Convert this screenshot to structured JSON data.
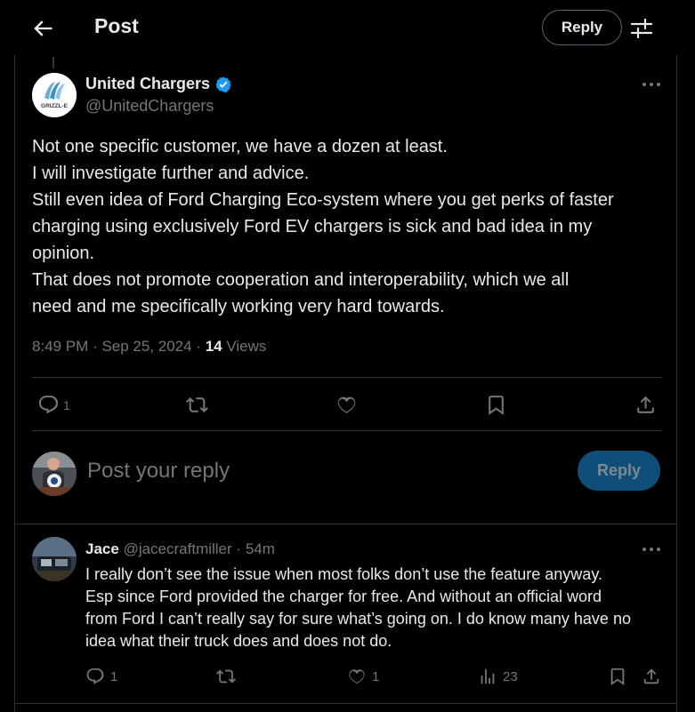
{
  "header": {
    "title": "Post",
    "reply_label": "Reply"
  },
  "post": {
    "author_name": "United Chargers",
    "author_handle": "@UnitedChargers",
    "avatar_text": "GRIZZL-E",
    "lines": [
      "Not one specific customer, we have a dozen at least.",
      "I will investigate further and advice.",
      "Still even idea of Ford Charging Eco-system where you get perks of faster",
      "charging using exclusively Ford EV chargers is sick and bad idea in my",
      "opinion.",
      "That does not promote cooperation and interoperability, which we all",
      "need and me specifically working very hard towards."
    ],
    "time": "8:49 PM",
    "date": "Sep 25, 2024",
    "views_count": "14",
    "views_label": "Views",
    "reply_count": "1"
  },
  "compose": {
    "placeholder": "Post your reply",
    "button": "Reply"
  },
  "reply": {
    "name": "Jace",
    "handle": "@jacecraftmiller",
    "age": "54m",
    "lines": [
      "I really don’t see the issue when most folks don’t use the feature anyway.",
      "Esp since Ford provided the charger for free. And without an official word",
      "from Ford I can’t really say for sure what’s going on. I do know many have no",
      "idea what their truck does and does not do."
    ],
    "reply_count": "1",
    "like_count": "1",
    "views_count": "23"
  },
  "colors": {
    "background": "#000000",
    "text": "#e7e9ea",
    "muted": "#71767b",
    "accent": "#1d9bf0",
    "reply_disabled": "#0f4e78",
    "border": "#2f3336"
  },
  "icons": [
    "back-arrow-icon",
    "sliders-icon",
    "verified-badge-icon",
    "more-icon",
    "comment-icon",
    "retweet-icon",
    "like-icon",
    "bookmark-icon",
    "share-icon",
    "views-icon"
  ]
}
